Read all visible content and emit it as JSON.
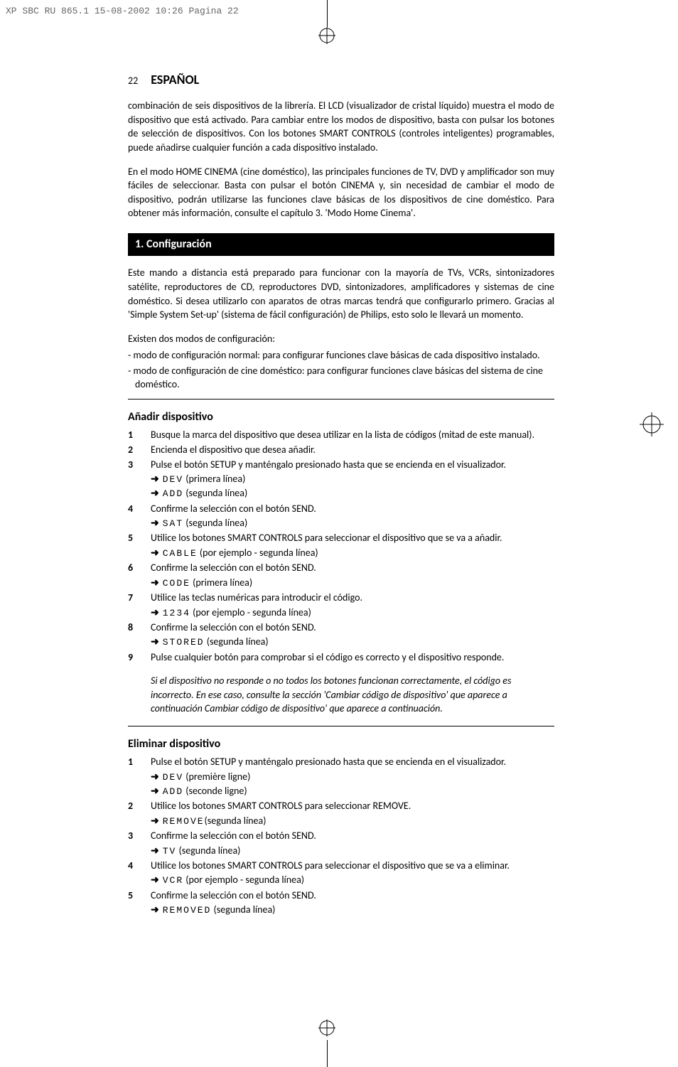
{
  "header": {
    "filepath": "XP SBC RU 865.1  15-08-2002 10:26  Pagina 22"
  },
  "page": {
    "num": "22",
    "lang": "ESPAÑOL"
  },
  "intro": {
    "p1": "combinación de seis dispositivos de la librería. El LCD (visualizador de cristal líquido) muestra el modo de dispositivo que está activado. Para cambiar entre los modos de dispositivo, basta con pulsar los botones de selección de dispositivos. Con los botones SMART CONTROLS (controles inteligentes) programables, puede añadirse cualquier función a cada dispositivo instalado.",
    "p2": "En el modo HOME CINEMA (cine doméstico), las principales funciones de TV, DVD y amplificador son muy fáciles de seleccionar. Basta con pulsar el botón CINEMA y, sin necesidad de cambiar el modo de dispositivo, podrán utilizarse las funciones clave básicas de los dispositivos de cine doméstico. Para obtener más información, consulte el capítulo 3. 'Modo Home Cinema'."
  },
  "s1": {
    "title": "1. Configuración",
    "p1": "Este mando a distancia está preparado para funcionar con la mayoría de TVs, VCRs, sintonizadores satélite, reproductores de CD, reproductores DVD, sintonizadores, amplificadores y sistemas de cine doméstico. Si desea utilizarlo con aparatos de otras marcas tendrá que configurarlo primero. Gracias al 'Simple System Set-up' (sistema de fácil configuración) de Philips, esto solo le llevará un momento.",
    "p2": "Existen dos modos de configuración:",
    "d1": "- modo de configuración normal: para configurar funciones clave básicas de cada dispositivo instalado.",
    "d2": "- modo de configuración de cine doméstico: para configurar funciones clave básicas del sistema de cine doméstico."
  },
  "add": {
    "title": "Añadir dispositivo",
    "i": [
      {
        "n": "1",
        "t": "Busque la marca del dispositivo que desea utilizar en la lista de códigos (mitad de este manual)."
      },
      {
        "n": "2",
        "t": "Encienda el dispositivo que desea añadir."
      },
      {
        "n": "3",
        "t": "Pulse el botón SETUP y manténgalo presionado hasta que se encienda en el visualizador.",
        "s": [
          {
            "c": "DEV",
            "t": "  (primera línea)"
          },
          {
            "c": "ADD",
            "t": "  (segunda línea)"
          }
        ]
      },
      {
        "n": "4",
        "t": "Confirme la selección con el botón SEND.",
        "s": [
          {
            "c": "SAT",
            "t": "  (segunda línea)"
          }
        ]
      },
      {
        "n": "5",
        "t": "Utilice los botones SMART CONTROLS para seleccionar el dispositivo que se va a añadir.",
        "s": [
          {
            "c": "CABLE",
            "t": "  (por ejemplo - segunda línea)"
          }
        ]
      },
      {
        "n": "6",
        "t": "Confirme la selección con el botón SEND.",
        "s": [
          {
            "c": "CODE",
            "t": "  (primera línea)"
          }
        ]
      },
      {
        "n": "7",
        "t": "Utilice las teclas numéricas para introducir el código.",
        "s": [
          {
            "c": "1234",
            "t": "  (por ejemplo - segunda línea)"
          }
        ]
      },
      {
        "n": "8",
        "t": "Confirme la selección con el botón SEND.",
        "s": [
          {
            "c": "STORED",
            "t": " (segunda línea)"
          }
        ]
      },
      {
        "n": "9",
        "t": "Pulse cualquier botón para comprobar si el código es correcto y el dispositivo responde."
      }
    ],
    "note": "Si el dispositivo no responde o no todos los botones funcionan correctamente, el código es incorrecto. En ese caso, consulte la sección 'Cambiar código de dispositivo' que aparece a continuación Cambiar código de dispositivo' que aparece a continuación."
  },
  "rem": {
    "title": "Eliminar dispositivo",
    "i": [
      {
        "n": "1",
        "t": "Pulse el botón SETUP y manténgalo presionado hasta que se encienda en el visualizador.",
        "s": [
          {
            "c": "DEV",
            "t": "  (première ligne)"
          },
          {
            "c": "ADD",
            "t": "  (seconde ligne)"
          }
        ]
      },
      {
        "n": "2",
        "t": "Utilice los botones SMART CONTROLS para seleccionar REMOVE.",
        "s": [
          {
            "c": "REMOVE",
            "t": "(segunda línea)"
          }
        ]
      },
      {
        "n": "3",
        "t": "Confirme la selección con el botón SEND.",
        "s": [
          {
            "c": "TV",
            "t": " (segunda línea)"
          }
        ]
      },
      {
        "n": "4",
        "t": "Utilice los botones SMART CONTROLS para seleccionar el dispositivo que se va a eliminar.",
        "s": [
          {
            "c": "VCR",
            "t": " (por ejemplo - segunda línea)"
          }
        ]
      },
      {
        "n": "5",
        "t": "Confirme la selección con el botón SEND.",
        "s": [
          {
            "c": "REMOVED",
            "t": " (segunda línea)"
          }
        ]
      }
    ]
  }
}
